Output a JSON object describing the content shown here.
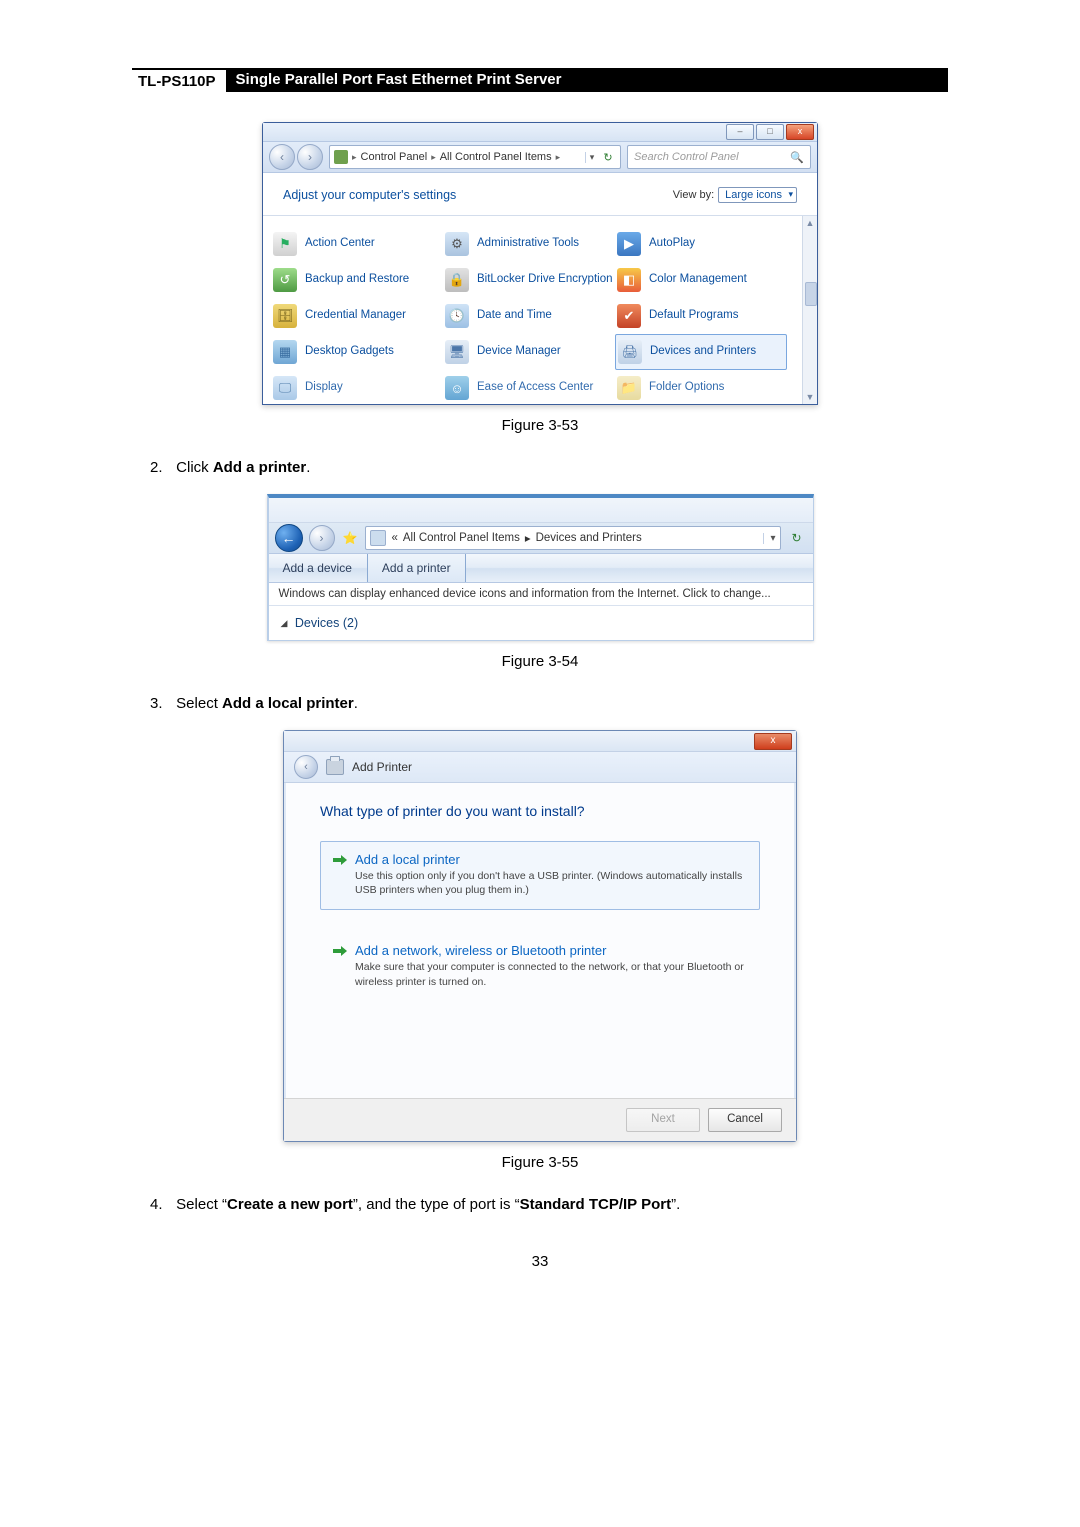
{
  "doc": {
    "model": "TL-PS110P",
    "title": "Single Parallel Port Fast Ethernet Print Server",
    "page_number": "33"
  },
  "steps": {
    "s2_num": "2.",
    "s2_pre": "Click ",
    "s2_bold": "Add a printer",
    "s2_post": ".",
    "s3_num": "3.",
    "s3_pre": "Select ",
    "s3_bold": "Add a local printer",
    "s3_post": ".",
    "s4_num": "4.",
    "s4_a": "Select “",
    "s4_b": "Create a new port",
    "s4_c": "”, and the type of port is “",
    "s4_d": "Standard TCP/IP Port",
    "s4_e": "”."
  },
  "captions": {
    "c1": "Figure 3-53",
    "c2": "Figure 3-54",
    "c3": "Figure 3-55"
  },
  "fig1": {
    "win_min": "–",
    "win_max": "□",
    "win_close": "x",
    "nav_back": "‹",
    "nav_fwd": "›",
    "crumb_sep": "▸",
    "crumb1": "Control Panel",
    "crumb2": "All Control Panel Items",
    "addr_dd": "▾",
    "addr_refresh": "↻",
    "search_placeholder": "Search Control Panel",
    "search_icon": "🔍",
    "heading": "Adjust your computer's settings",
    "viewby_label": "View by:",
    "viewby_value": "Large icons",
    "items": {
      "i0": "Action Center",
      "i1": "Administrative Tools",
      "i2": "AutoPlay",
      "i3": "Backup and Restore",
      "i4": "BitLocker Drive Encryption",
      "i5": "Color Management",
      "i6": "Credential Manager",
      "i7": "Date and Time",
      "i8": "Default Programs",
      "i9": "Desktop Gadgets",
      "i10": "Device Manager",
      "i11": "Devices and Printers",
      "i12": "Display",
      "i13": "Ease of Access Center",
      "i14": "Folder Options"
    },
    "scroll_up": "▲",
    "scroll_down": "▼"
  },
  "fig2": {
    "back": "←",
    "fwd": "›",
    "fav": "⭐",
    "crumb_laquo": "«",
    "crumb_sep": "▸",
    "crumb1": "All Control Panel Items",
    "crumb2": "Devices and Printers",
    "addr_dd": "▾",
    "refresh": "↻",
    "tool_add_device": "Add a device",
    "tool_add_printer": "Add a printer",
    "infobar": "Windows can display enhanced device icons and information from the Internet. Click to change...",
    "section_tri": "◢",
    "section": "Devices (2)"
  },
  "fig3": {
    "close": "x",
    "back": "‹",
    "title": "Add Printer",
    "question": "What type of printer do you want to install?",
    "opt1_title": "Add a local printer",
    "opt1_desc": "Use this option only if you don't have a USB printer. (Windows automatically installs USB printers when you plug them in.)",
    "opt2_title": "Add a network, wireless or Bluetooth printer",
    "opt2_desc": "Make sure that your computer is connected to the network, or that your Bluetooth or wireless printer is turned on.",
    "btn_next": "Next",
    "btn_cancel": "Cancel"
  }
}
